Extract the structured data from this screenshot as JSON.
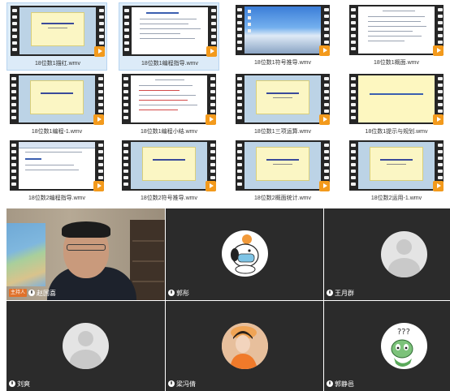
{
  "files": [
    {
      "name": "18位数1描红.wmv",
      "style": "yellow",
      "selected": true
    },
    {
      "name": "18位数1编程指导.wmv",
      "style": "doc",
      "selected": true
    },
    {
      "name": "18位数1符号推导.wmv",
      "style": "desk",
      "selected": false
    },
    {
      "name": "18位数1概面.wmv",
      "style": "doc",
      "selected": false
    },
    {
      "name": "18位数1编程-1.wmv",
      "style": "yellow",
      "selected": false
    },
    {
      "name": "18位数1编程小结.wmv",
      "style": "doc",
      "selected": false
    },
    {
      "name": "18位数1三项运算.wmv",
      "style": "yellow",
      "selected": false
    },
    {
      "name": "18位数1提示与规划.wmv",
      "style": "yfull",
      "selected": false
    },
    {
      "name": "18位数2编程指导.wmv",
      "style": "toolbar",
      "selected": false
    },
    {
      "name": "18位数2符号推导.wmv",
      "style": "yellow",
      "selected": false
    },
    {
      "name": "18位数2概面统计.wmv",
      "style": "yellow",
      "selected": false
    },
    {
      "name": "18位数2运用-1.wmv",
      "style": "yellow",
      "selected": false
    }
  ],
  "participants": [
    {
      "name": "赵国喜",
      "host": true,
      "host_label": "主持人",
      "avatar": "video"
    },
    {
      "name": "郭彤",
      "host": false,
      "avatar": "cartoon-dog"
    },
    {
      "name": "王月群",
      "host": false,
      "avatar": "default"
    },
    {
      "name": "刘爽",
      "host": false,
      "avatar": "default"
    },
    {
      "name": "梁冯倩",
      "host": false,
      "avatar": "photo-girl"
    },
    {
      "name": "郭静邑",
      "host": false,
      "avatar": "cartoon-dino"
    }
  ],
  "colors": {
    "accent": "#f39a1c",
    "host_badge": "#e0712a",
    "tile_bg": "#2b2b2b",
    "selection": "#dcebf8"
  }
}
